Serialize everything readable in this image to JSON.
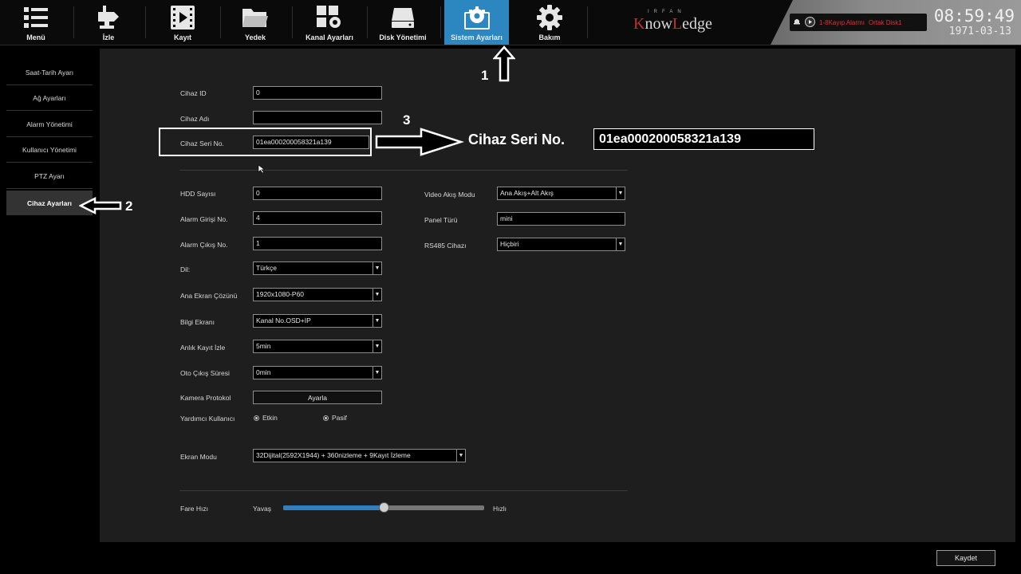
{
  "nav": {
    "items": [
      {
        "label": "Menü",
        "icon": "menu-grid-icon"
      },
      {
        "label": "İzle",
        "icon": "camera-icon"
      },
      {
        "label": "Kayıt",
        "icon": "film-icon"
      },
      {
        "label": "Yedek",
        "icon": "folder-icon"
      },
      {
        "label": "Kanal Ayarları",
        "icon": "channel-settings-icon"
      },
      {
        "label": "Disk Yönetimi",
        "icon": "disk-icon"
      },
      {
        "label": "Sistem Ayarları",
        "icon": "system-settings-icon",
        "active": true
      },
      {
        "label": "Bakım",
        "icon": "gear-icon"
      }
    ]
  },
  "logo": {
    "small": "IRFAN",
    "brand_k": "K",
    "brand_mid": "now",
    "brand_l": "L",
    "brand_end": "edge"
  },
  "status": {
    "alarm1": "1-8Kayıp Alarmı",
    "alarm2": "Ortak Disk1"
  },
  "clock": {
    "time": "08:59:49",
    "date": "1971-03-13"
  },
  "sidebar": {
    "items": [
      {
        "label": "Saat-Tarih Ayarı"
      },
      {
        "label": "Ağ Ayarları"
      },
      {
        "label": "Alarm Yönetimi"
      },
      {
        "label": "Kullanıcı Yönetimi"
      },
      {
        "label": "PTZ Ayarı"
      },
      {
        "label": "Cihaz Ayarları",
        "active": true
      }
    ]
  },
  "form": {
    "device_id": {
      "label": "Cihaz ID",
      "value": "0"
    },
    "device_name": {
      "label": "Cihaz Adı",
      "value": ""
    },
    "serial": {
      "label": "Cihaz Seri No.",
      "value": "01ea000200058321a139"
    },
    "hdd_count": {
      "label": "HDD Sayısı",
      "value": "0"
    },
    "alarm_in": {
      "label": "Alarm Girişi No.",
      "value": "4"
    },
    "alarm_out": {
      "label": "Alarm Çıkış No.",
      "value": "1"
    },
    "language": {
      "label": "Dil:",
      "value": "Türkçe"
    },
    "resolution": {
      "label": "Ana Ekran Çözünü",
      "value": "1920x1080-P60"
    },
    "info_screen": {
      "label": "Bilgi Ekranı",
      "value": "Kanal No.OSD+IP"
    },
    "instant_record": {
      "label": "Anlık Kayıt İzle",
      "value": "5min"
    },
    "auto_exit": {
      "label": "Oto Çıkış Süresi",
      "value": "0min"
    },
    "camera_protocol": {
      "label": "Kamera Protokol",
      "button": "Ayarla"
    },
    "helper_user": {
      "label": "Yardımcı Kullanıcı",
      "opt1": "Etkin",
      "opt2": "Pasif"
    },
    "screen_mode": {
      "label": "Ekran Modu",
      "value": "32Dijital(2592X1944) + 360nizleme + 9Kayıt İzleme"
    },
    "video_stream": {
      "label": "Video Akış Modu",
      "value": "Ana Akış+Alt Akış"
    },
    "panel_type": {
      "label": "Panel Türü",
      "value": "mini"
    },
    "rs485": {
      "label": "RS485 Cihazı",
      "value": "Hiçbiri"
    },
    "mouse_speed": {
      "label": "Fare Hızı",
      "slow": "Yavaş",
      "fast": "Hızlı",
      "level": 0.5
    }
  },
  "save_label": "Kaydet",
  "annotations": {
    "step1": "1",
    "step2": "2",
    "step3": "3",
    "callout_label": "Cihaz Seri No.",
    "callout_value": "01ea000200058321a139"
  }
}
